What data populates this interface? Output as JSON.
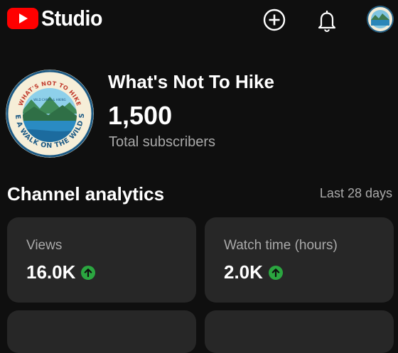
{
  "header": {
    "app_name": "Studio",
    "icons": [
      "youtube-logo-icon",
      "create-icon",
      "notifications-bell-icon"
    ]
  },
  "channel": {
    "name": "What's Not To Hike",
    "subscriber_count": "1,500",
    "subscriber_label": "Total subscribers",
    "logo_text": {
      "top": "WHAT'S NOT TO HIKE",
      "sub": "WILD CAMPS & HIKING",
      "bottom": "TAKE A WALK ON THE WILD SIDE"
    }
  },
  "analytics": {
    "title": "Channel analytics",
    "period": "Last 28 days",
    "cards": [
      {
        "label": "Views",
        "value": "16.0K",
        "trend": "up"
      },
      {
        "label": "Watch time (hours)",
        "value": "2.0K",
        "trend": "up"
      }
    ]
  },
  "colors": {
    "background": "#0f0f0f",
    "card": "#272727",
    "youtube_red": "#ff0000",
    "trend_up": "#2ba640"
  }
}
